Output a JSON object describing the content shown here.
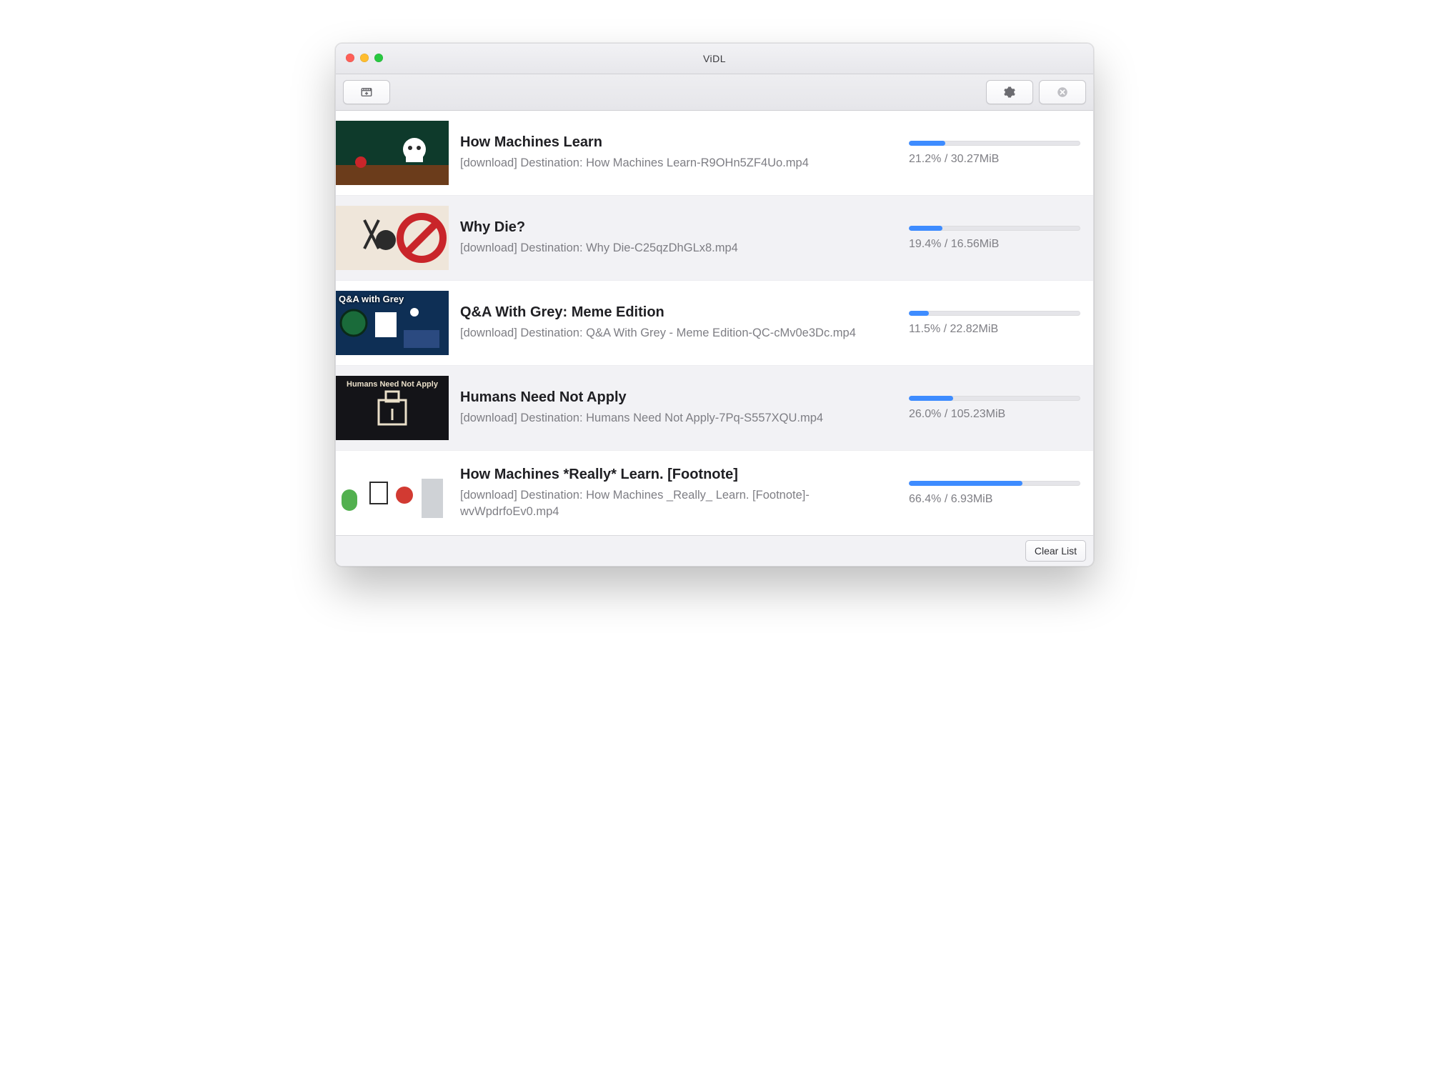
{
  "window": {
    "title": "ViDL"
  },
  "toolbar": {
    "add_icon": "add-video-icon",
    "settings_icon": "gear-icon",
    "cancel_icon": "cancel-icon"
  },
  "footer": {
    "clear_label": "Clear List"
  },
  "downloads": [
    {
      "title": "How Machines Learn",
      "status": "[download] Destination: How Machines Learn-R9OHn5ZF4Uo.mp4",
      "progress_text": "21.2% / 30.27MiB",
      "percent": 21.2,
      "thumb_label": ""
    },
    {
      "title": "Why Die?",
      "status": "[download] Destination: Why Die-C25qzDhGLx8.mp4",
      "progress_text": "19.4% / 16.56MiB",
      "percent": 19.4,
      "thumb_label": ""
    },
    {
      "title": "Q&A With Grey: Meme Edition",
      "status": "[download] Destination: Q&A With Grey - Meme Edition-QC-cMv0e3Dc.mp4",
      "progress_text": "11.5% / 22.82MiB",
      "percent": 11.5,
      "thumb_label": "Q&A with Grey"
    },
    {
      "title": "Humans Need Not Apply",
      "status": "[download] Destination: Humans Need Not Apply-7Pq-S557XQU.mp4",
      "progress_text": "26.0% / 105.23MiB",
      "percent": 26.0,
      "thumb_label": "Humans Need Not Apply"
    },
    {
      "title": "How Machines *Really* Learn.  [Footnote]",
      "status": "[download] Destination: How Machines _Really_ Learn.  [Footnote]-wvWpdrfoEv0.mp4",
      "progress_text": "66.4% / 6.93MiB",
      "percent": 66.4,
      "thumb_label": ""
    }
  ]
}
